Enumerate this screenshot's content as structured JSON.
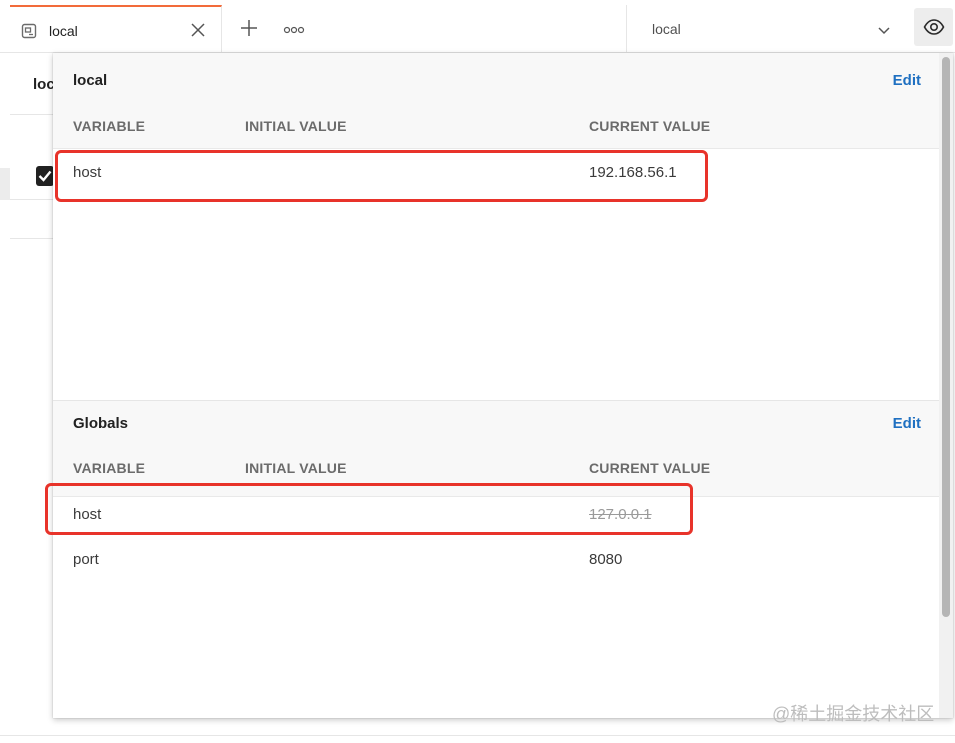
{
  "tab": {
    "label": "local",
    "icon": "environment-tab-icon"
  },
  "toolbar": {
    "add_icon": "plus-icon",
    "more_icon": "ellipsis-icon"
  },
  "environment_selector": {
    "value": "local",
    "icon": "chevron-down-icon"
  },
  "quick_look": {
    "icon": "eye-icon"
  },
  "background_page": {
    "title_fragment": "loc"
  },
  "popover": {
    "environment": {
      "title": "local",
      "edit_label": "Edit",
      "columns": [
        "VARIABLE",
        "INITIAL VALUE",
        "CURRENT VALUE"
      ],
      "rows": [
        {
          "variable": "host",
          "initial_value": "",
          "current_value": "192.168.56.1"
        }
      ]
    },
    "globals": {
      "title": "Globals",
      "edit_label": "Edit",
      "columns": [
        "VARIABLE",
        "INITIAL VALUE",
        "CURRENT VALUE"
      ],
      "rows": [
        {
          "variable": "host",
          "initial_value": "",
          "current_value": "127.0.0.1",
          "overridden": true
        },
        {
          "variable": "port",
          "initial_value": "",
          "current_value": "8080"
        }
      ]
    }
  },
  "colors": {
    "accent_tab": "#f26b3a",
    "edit_link": "#1f70c1",
    "highlight": "#e8332a"
  },
  "watermark": "@稀土掘金技术社区"
}
